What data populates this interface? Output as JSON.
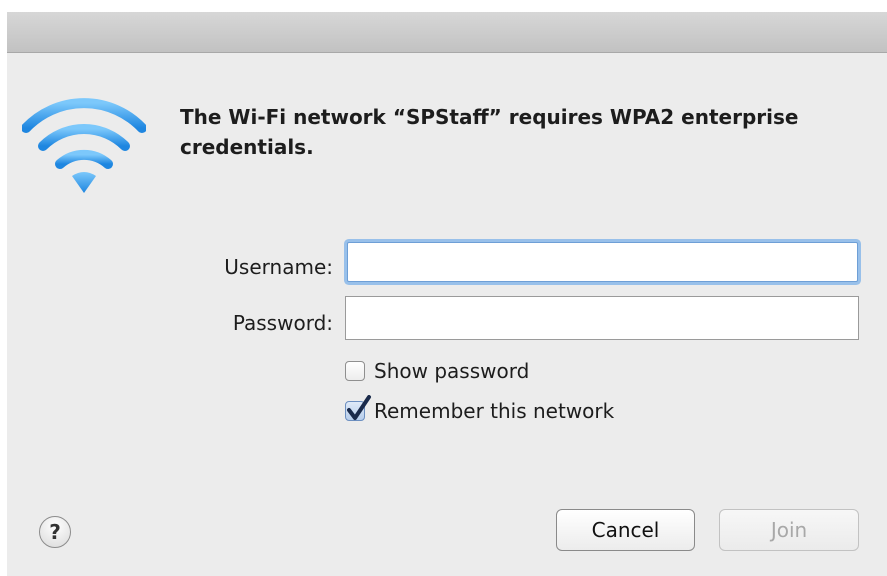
{
  "dialog": {
    "message": "The Wi-Fi network “SPStaff” requires WPA2 enterprise credentials."
  },
  "form": {
    "username_label": "Username:",
    "username_value": "",
    "password_label": "Password:",
    "password_value": ""
  },
  "options": {
    "show_password": {
      "label": "Show password",
      "checked": false
    },
    "remember_network": {
      "label": "Remember this network",
      "checked": true
    }
  },
  "buttons": {
    "help": "?",
    "cancel": "Cancel",
    "join": "Join"
  },
  "colors": {
    "wifi_icon": "#3aa0ee",
    "focus_ring": "#98c0ea",
    "dialog_background": "#ececec",
    "checkmark": "#1a2a4a"
  },
  "icons": {
    "app": "wifi-icon",
    "help": "help-icon",
    "check": "checkmark-icon"
  }
}
